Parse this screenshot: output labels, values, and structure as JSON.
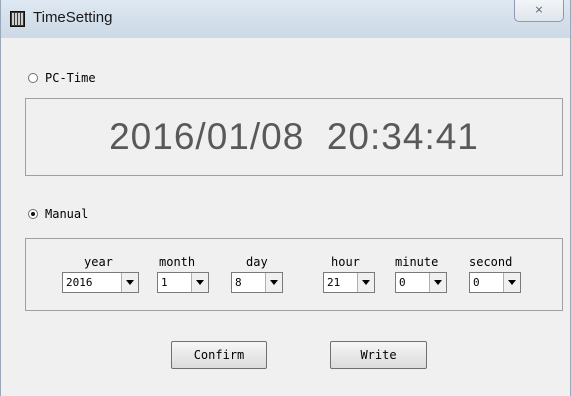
{
  "window": {
    "title": "TimeSetting",
    "close_glyph": "☒"
  },
  "pc_time": {
    "label": "PC-Time",
    "selected": false,
    "display": "2016/01/08  20:34:41"
  },
  "manual": {
    "label": "Manual",
    "selected": true,
    "fields": [
      {
        "label": "year",
        "value": "2016"
      },
      {
        "label": "month",
        "value": "1"
      },
      {
        "label": "day",
        "value": "8"
      },
      {
        "label": "hour",
        "value": "21"
      },
      {
        "label": "minute",
        "value": "0"
      },
      {
        "label": "second",
        "value": "0"
      }
    ]
  },
  "buttons": {
    "confirm": "Confirm",
    "write": "Write"
  }
}
